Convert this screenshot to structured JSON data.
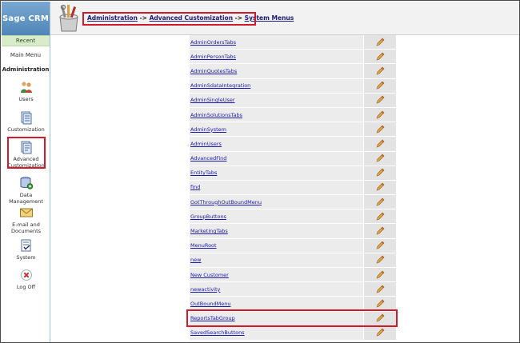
{
  "sidebar": {
    "brand": "Sage CRM",
    "recent": "Recent",
    "main_menu": "Main Menu",
    "section": "Administration",
    "items": [
      {
        "label": "Users",
        "icon": "users-icon"
      },
      {
        "label": "Customization",
        "icon": "customization-icon"
      },
      {
        "label": "Advanced Customization",
        "icon": "advanced-customization-icon"
      },
      {
        "label": "Data Management",
        "icon": "data-management-icon"
      },
      {
        "label": "E-mail and Documents",
        "icon": "email-documents-icon"
      },
      {
        "label": "System",
        "icon": "system-icon"
      },
      {
        "label": "Log Off",
        "icon": "log-off-icon"
      }
    ]
  },
  "header": {
    "icon": "tools-icon",
    "breadcrumb": {
      "administration": "Administration",
      "sep1": " -> ",
      "advanced": "Advanced Customization",
      "sep2": " -> ",
      "current": "System Menus"
    }
  },
  "menus": [
    "AdminOrdersTabs",
    "AdminPersonTabs",
    "AdminQuotesTabs",
    "AdminSdataIntegration",
    "AdminSingleUser",
    "AdminSolutionsTabs",
    "AdminSystem",
    "AdminUsers",
    "AdvancedFind",
    "EntityTabs",
    "find",
    "GotThroughOutBoundMenu",
    "GroupButtons",
    "MarketingTabs",
    "MenuRoot",
    "new",
    "New Customer",
    "newactivity",
    "OutBoundMenu",
    "ReportsTabGroup",
    "SavedSearchButtons"
  ],
  "colors": {
    "highlight": "#d11a2a",
    "brand": "#5f93c0",
    "link": "#1a1aa6"
  }
}
